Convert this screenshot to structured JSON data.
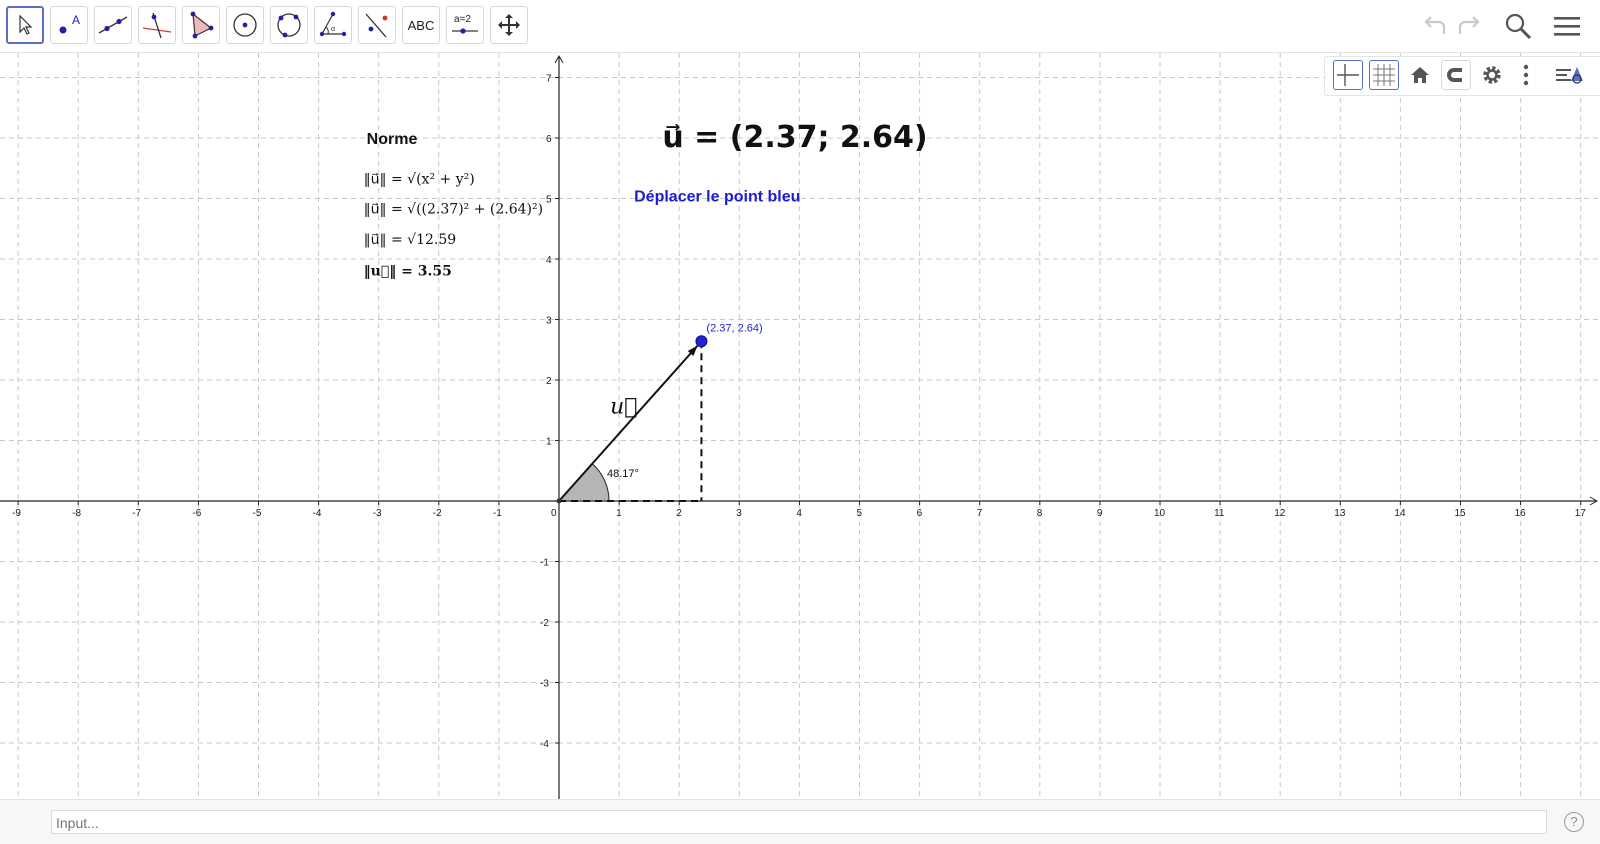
{
  "toolbar": {
    "tools": [
      {
        "name": "Move",
        "icon": "cursor-arrow-icon"
      },
      {
        "name": "Point",
        "icon": "point-icon",
        "text": "A"
      },
      {
        "name": "Line",
        "icon": "line-icon"
      },
      {
        "name": "Perpendicular Line",
        "icon": "perpendicular-icon"
      },
      {
        "name": "Polygon",
        "icon": "polygon-icon"
      },
      {
        "name": "Circle with Center",
        "icon": "circle-center-icon"
      },
      {
        "name": "Circle through 3 Points",
        "icon": "circle-3points-icon"
      },
      {
        "name": "Angle",
        "icon": "angle-icon"
      },
      {
        "name": "Reflect",
        "icon": "reflect-icon"
      },
      {
        "name": "Text",
        "icon": "text-icon",
        "text": "ABC"
      },
      {
        "name": "Slider",
        "icon": "slider-icon",
        "text": "a=2"
      },
      {
        "name": "Move Graphics View",
        "icon": "move-view-icon"
      }
    ],
    "right": [
      "undo-icon",
      "redo-icon",
      "search-icon",
      "menu-icon"
    ]
  },
  "style_bar": [
    "axes-icon",
    "grid-icon",
    "home-icon",
    "magnet-icon",
    "gear-icon",
    "more-vertical-icon",
    "style-toggle-icon"
  ],
  "graph": {
    "x_ticks": [
      "-9",
      "-8",
      "-7",
      "-6",
      "-5",
      "-4",
      "-3",
      "-2",
      "-1",
      "0",
      "1",
      "2",
      "3",
      "4",
      "5",
      "6",
      "7",
      "8",
      "9",
      "10",
      "11",
      "12",
      "13",
      "14",
      "15",
      "16",
      "17"
    ],
    "y_ticks": [
      "7",
      "6",
      "5",
      "4",
      "3",
      "2",
      "1",
      "-1",
      "-2",
      "-3",
      "-4"
    ],
    "xlim": [
      -9.2,
      17.3
    ],
    "ylim": [
      -4.9,
      7.4
    ],
    "point": {
      "x": 2.37,
      "y": 2.64,
      "label": "(2.37, 2.64)",
      "color": "#2121d6"
    },
    "vector_label": "u⃗",
    "angle_label": "48.17°",
    "angle_deg": 48.17
  },
  "texts": {
    "vector_def": "u⃗ = (2.37; 2.64)",
    "instruction": "Déplacer le point bleu",
    "norme_title": "Norme",
    "norme_line1": "‖u⃗‖ = √(x² + y²)",
    "norme_line2": "‖u⃗‖ = √((2.37)² + (2.64)²)",
    "norme_line3": "‖u⃗‖ = √12.59",
    "norme_line4": "‖u⃗‖ = 3.55"
  },
  "input": {
    "placeholder": "Input..."
  },
  "help_label": "?"
}
